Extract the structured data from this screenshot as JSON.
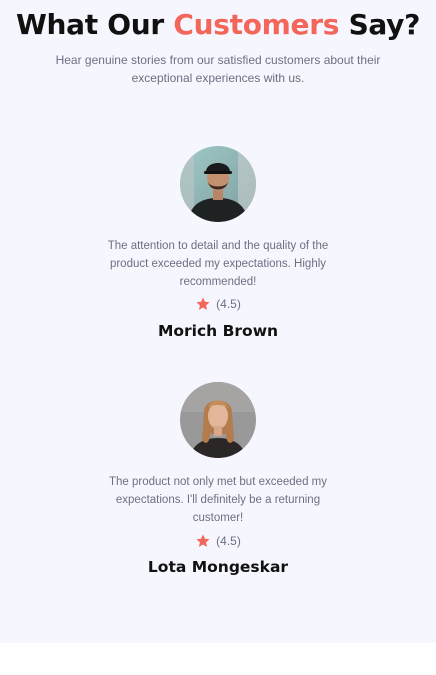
{
  "header": {
    "title_prefix": "What Our",
    "title_accent": "Customers",
    "title_suffix": "Say?",
    "subtitle": "Hear genuine stories from our satisfied customers about their exceptional experiences with us."
  },
  "testimonials": [
    {
      "quote": "The attention to detail and the quality of the product exceeded my expectations. Highly recommended!",
      "rating": 4.5,
      "rating_label": "(4.5)",
      "name": "Morich Brown",
      "avatar": "man-portrait-with-cap"
    },
    {
      "quote": "The product not only met but exceeded my expectations. I'll definitely be a returning customer!",
      "rating": 4.5,
      "rating_label": "(4.5)",
      "name": "Lota Mongeskar",
      "avatar": "woman-portrait-blonde"
    }
  ],
  "colors": {
    "accent": "#f4655a",
    "background": "#f5f6fe",
    "text": "#111111",
    "muted": "#6d6f80"
  },
  "icons": {
    "rating": "star-icon"
  }
}
